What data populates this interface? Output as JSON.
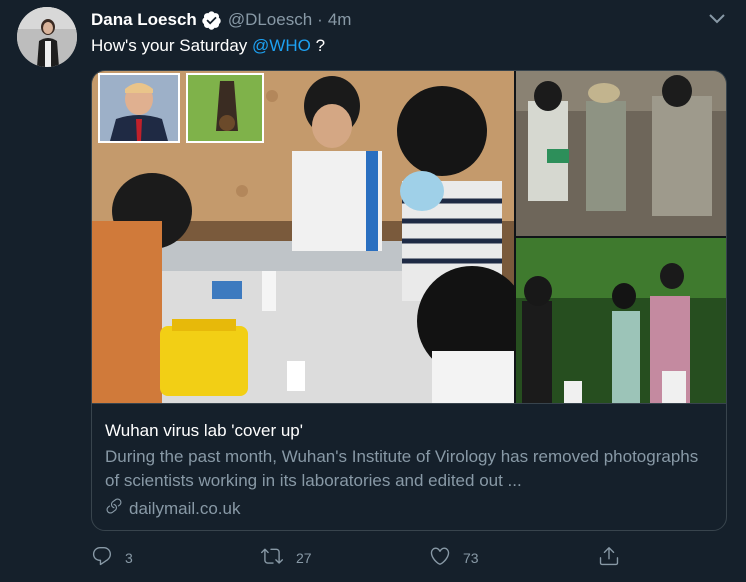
{
  "tweet": {
    "author_name": "Dana Loesch",
    "author_handle": "@DLoesch",
    "separator": "·",
    "timestamp": "4m",
    "text_before": "How's your Saturday ",
    "mention": "@WHO",
    "text_after": " ?"
  },
  "card": {
    "title": "Wuhan virus lab 'cover up'",
    "description": "During the past month, Wuhan's Institute of Virology has removed photographs of scientists working in its laboratories and edited out ...",
    "domain": "dailymail.co.uk"
  },
  "actions": {
    "replies": "3",
    "retweets": "27",
    "likes": "73"
  },
  "icons": {
    "verified": "verified-badge-icon",
    "caret": "chevron-down-icon",
    "link": "link-icon",
    "reply": "reply-icon",
    "retweet": "retweet-icon",
    "like": "heart-icon",
    "share": "share-icon"
  },
  "colors": {
    "background": "#15202b",
    "accent": "#1da1f2",
    "muted": "#8899a6",
    "border": "#38444d"
  }
}
